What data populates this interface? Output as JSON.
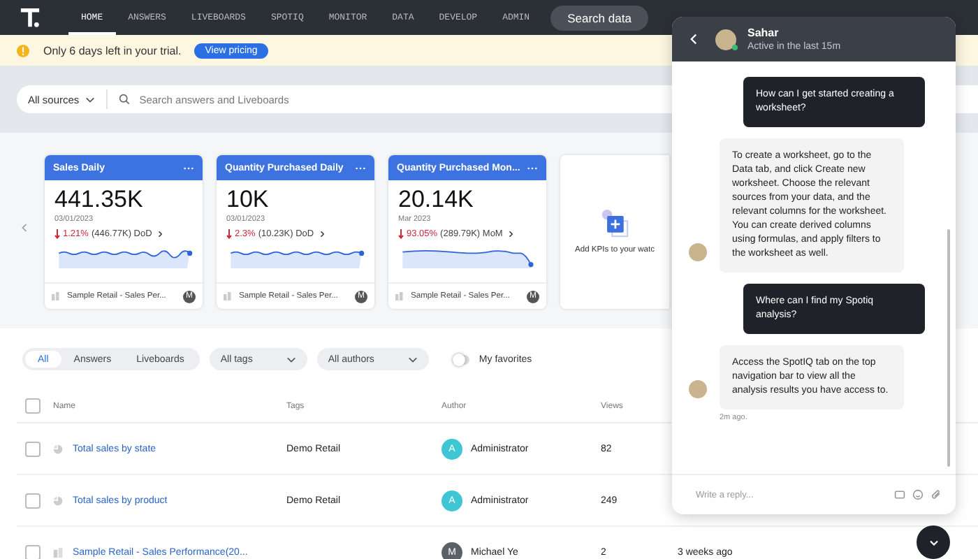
{
  "nav": {
    "items": [
      {
        "label": "HOME",
        "selected": true
      },
      {
        "label": "ANSWERS",
        "selected": false
      },
      {
        "label": "LIVEBOARDS",
        "selected": false
      },
      {
        "label": "SPOTIQ",
        "selected": false
      },
      {
        "label": "MONITOR",
        "selected": false
      },
      {
        "label": "DATA",
        "selected": false
      },
      {
        "label": "DEVELOP",
        "selected": false
      },
      {
        "label": "ADMIN",
        "selected": false
      }
    ],
    "search_button": "Search data"
  },
  "banner": {
    "text": "Only 6 days left in your trial.",
    "button": "View pricing"
  },
  "search": {
    "source": "All sources",
    "placeholder": "Search answers and Liveboards"
  },
  "kpis": [
    {
      "title": "Sales Daily",
      "value": "441.35K",
      "date": "03/01/2023",
      "change": "1.21%",
      "detail": "(446.77K) DoD",
      "source": "Sample Retail - Sales Per...",
      "owner": "M"
    },
    {
      "title": "Quantity Purchased Daily",
      "value": "10K",
      "date": "03/01/2023",
      "change": "2.3%",
      "detail": "(10.23K) DoD",
      "source": "Sample Retail - Sales Per...",
      "owner": "M"
    },
    {
      "title": "Quantity Purchased Mon...",
      "value": "20.14K",
      "date": "Mar 2023",
      "change": "93.05%",
      "detail": "(289.79K) MoM",
      "source": "Sample Retail - Sales Per...",
      "owner": "M"
    }
  ],
  "add_kpi": "Add KPIs to your watc",
  "filters": {
    "tabs": [
      {
        "label": "All",
        "selected": true
      },
      {
        "label": "Answers",
        "selected": false
      },
      {
        "label": "Liveboards",
        "selected": false
      }
    ],
    "tags": "All tags",
    "authors": "All authors",
    "favorites": {
      "label": "My favorites",
      "on": false
    }
  },
  "table": {
    "select_all_checked": false,
    "columns": [
      "Name",
      "Tags",
      "Author",
      "Views"
    ],
    "rows": [
      {
        "kind": "answer",
        "checked": false,
        "name": "Total sales by state",
        "tags": "Demo Retail",
        "initial": "A",
        "author": "Administrator",
        "color": "#3fc6d5",
        "views": "82"
      },
      {
        "kind": "answer",
        "checked": false,
        "name": "Total sales by product",
        "tags": "Demo Retail",
        "initial": "A",
        "author": "Administrator",
        "color": "#3fc6d5",
        "views": "249"
      },
      {
        "kind": "liveboard",
        "checked": false,
        "name": "Sample Retail - Sales Performance(20...",
        "initial": "M",
        "author": "Michael Ye",
        "color": "#5b6069",
        "views": "2",
        "modified": "3 weeks ago"
      }
    ]
  },
  "chat": {
    "name": "Sahar",
    "status": "Active in the last 15m",
    "messages": [
      {
        "kind": "user",
        "text": "How can I get started creating a worksheet?"
      },
      {
        "kind": "agent",
        "text": "To create a worksheet, go to the Data tab, and click Create new worksheet. Choose the relevant sources from your data, and the relevant columns for the worksheet. You can create derived columns using formulas, and apply filters to the worksheet as well."
      },
      {
        "kind": "user",
        "text": "Where can I find my Spotiq analysis?"
      },
      {
        "kind": "agent",
        "text": "Access the SpotIQ tab on the top navigation bar to view all the analysis results you have access to."
      }
    ],
    "time": "2m ago.",
    "reply_placeholder": "Write a reply..."
  }
}
